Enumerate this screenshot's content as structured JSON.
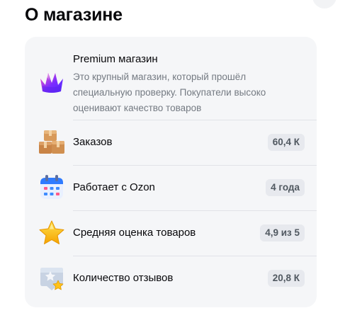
{
  "title": "О магазине",
  "premium": {
    "title": "Premium магазин",
    "description": "Это крупный магазин, который прошёл специальную проверку. Покупатели высоко оценивают качество товаров",
    "icon": "crown-icon"
  },
  "stats": [
    {
      "label": "Заказов",
      "value": "60,4 К",
      "icon": "boxes-icon"
    },
    {
      "label": "Работает с Ozon",
      "value": "4 года",
      "icon": "calendar-icon"
    },
    {
      "label": "Средняя оценка товаров",
      "value": "4,9 из 5",
      "icon": "star-icon"
    },
    {
      "label": "Количество отзывов",
      "value": "20,8 К",
      "icon": "review-icon"
    }
  ],
  "colors": {
    "card_background": "#f5f6f8",
    "badge_background": "#e7e9ee",
    "secondary_text": "#747a82",
    "crown_gradient": [
      "#ff5fbd",
      "#7b2cff",
      "#4f2dff"
    ]
  }
}
